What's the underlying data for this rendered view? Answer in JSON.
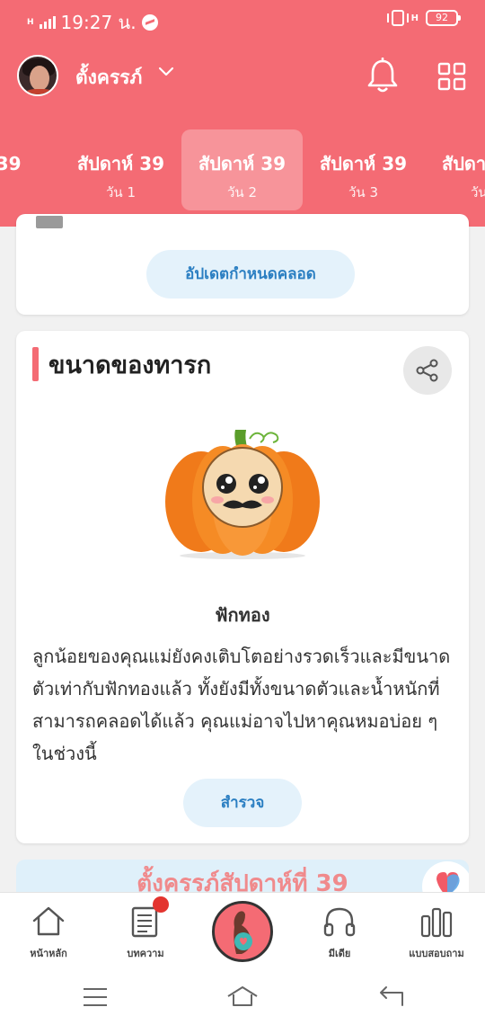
{
  "status_bar": {
    "signal": "H",
    "time": "19:27 น.",
    "network": "H",
    "battery": "92"
  },
  "profile": {
    "name": "ตั้งครรภ์"
  },
  "week_tabs": [
    {
      "week": "ห์ 39",
      "day": ""
    },
    {
      "week": "สัปดาห์ 39",
      "day": "วัน 1"
    },
    {
      "week": "สัปดาห์ 39",
      "day": "วัน 2"
    },
    {
      "week": "สัปดาห์ 39",
      "day": "วัน 3"
    },
    {
      "week": "สัปดา",
      "day": "วัน"
    }
  ],
  "active_tab": "สัปดาห์ 39 วัน 2",
  "due_date_card": {
    "update_button": "อัปเดตกำหนดคลอด"
  },
  "baby_size_card": {
    "title": "ขนาดของทารก",
    "fruit_name": "ฟักทอง",
    "description": "ลูกน้อยของคุณแม่ยังคงเติบโตอย่างรวดเร็วและมีขนาดตัวเท่ากับฟักทองแล้ว ทั้งยังมีทั้งขนาดตัวและน้ำหนักที่สามารถคลอดได้แล้ว คุณแม่อาจไปหาคุณหมอบ่อย ๆ ในช่วงนี้",
    "explore_button": "สำรวจ"
  },
  "banner": {
    "text": "ตั้งครรภ์สัปดาห์ที่ 39"
  },
  "bottom_nav": {
    "home": "หน้าหลัก",
    "articles": "บทความ",
    "media": "มีเดีย",
    "survey": "แบบสอบถาม"
  },
  "colors": {
    "brand": "#f46b74",
    "button_bg": "#e4f2fb",
    "button_text": "#2b7fc2",
    "notification": "#e3342f"
  }
}
